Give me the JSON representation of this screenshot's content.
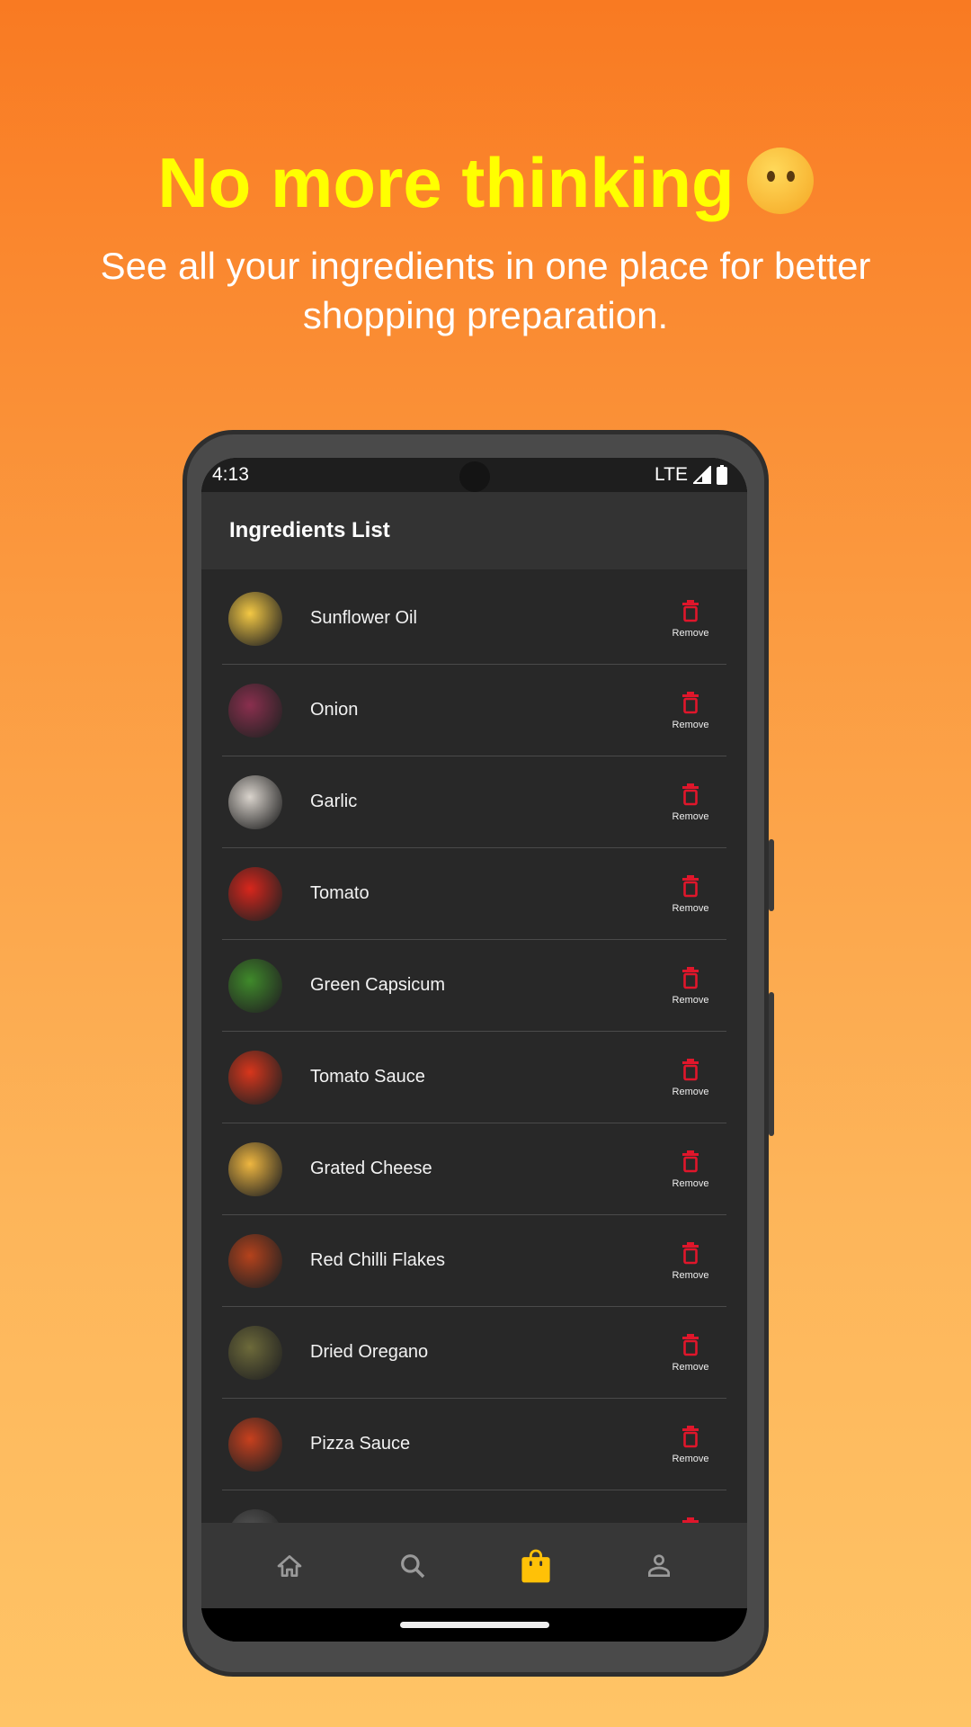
{
  "headline": "No more thinking",
  "headline_emoji": "thinking-face",
  "subtitle": "See all your ingredients in one place for better shopping preparation.",
  "status": {
    "time": "4:13",
    "network": "LTE"
  },
  "app": {
    "title": "Ingredients List",
    "remove_label": "Remove",
    "accent": "#ffc107",
    "remove_color": "#e0162b",
    "items": [
      {
        "name": "Sunflower Oil",
        "color": "#f3c844"
      },
      {
        "name": "Onion",
        "color": "#8a2f4e"
      },
      {
        "name": "Garlic",
        "color": "#d9d3cc"
      },
      {
        "name": "Tomato",
        "color": "#d8261c"
      },
      {
        "name": "Green Capsicum",
        "color": "#3f8a2a"
      },
      {
        "name": "Tomato Sauce",
        "color": "#d8361c"
      },
      {
        "name": "Grated Cheese",
        "color": "#eeb640"
      },
      {
        "name": "Red Chilli Flakes",
        "color": "#b5421c"
      },
      {
        "name": "Dried Oregano",
        "color": "#6d6a3a"
      },
      {
        "name": "Pizza Sauce",
        "color": "#c8401e"
      },
      {
        "name": "",
        "color": "#555"
      }
    ]
  },
  "nav": [
    {
      "icon": "home-icon"
    },
    {
      "icon": "search-icon"
    },
    {
      "icon": "shopping-bag-icon",
      "active": true
    },
    {
      "icon": "person-icon"
    }
  ]
}
